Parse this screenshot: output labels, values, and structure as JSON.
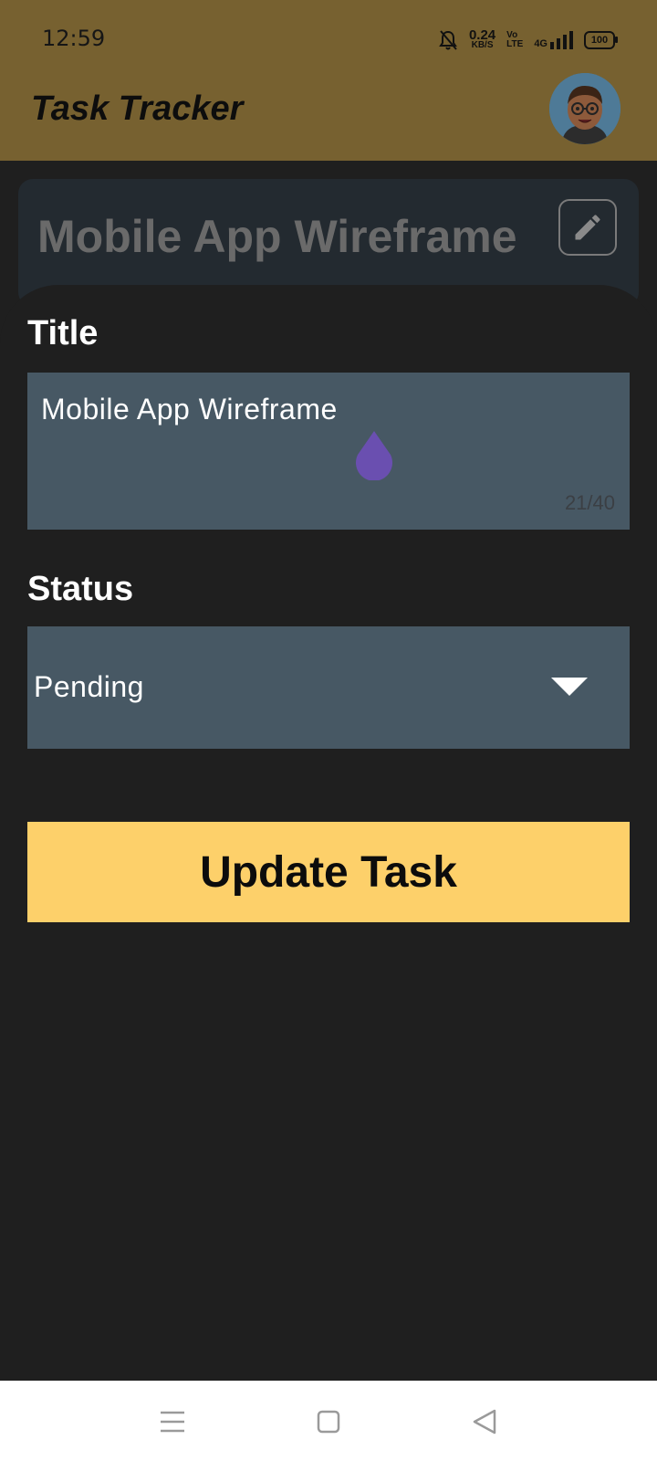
{
  "status_bar": {
    "time": "12:59",
    "net_speed_value": "0.24",
    "net_speed_unit": "KB/S",
    "volte_top": "Vo",
    "volte_bottom": "LTE",
    "network": "4G",
    "battery": "100"
  },
  "app_bar": {
    "title": "Task Tracker",
    "background_color": "#776130"
  },
  "task_card": {
    "title": "Mobile App Wireframe"
  },
  "form": {
    "title_label": "Title",
    "title_value": "Mobile App Wireframe",
    "title_counter": "21/40",
    "status_label": "Status",
    "status_value": "Pending",
    "submit_label": "Update Task",
    "submit_color": "#fdd06a",
    "field_color": "#475864"
  },
  "icons": {
    "edit": "pencil-icon",
    "dropdown": "triangle-down-icon",
    "cursor": "text-cursor-handle-icon",
    "nav_menu": "menu-icon",
    "nav_home": "home-square-icon",
    "nav_back": "back-triangle-icon"
  }
}
